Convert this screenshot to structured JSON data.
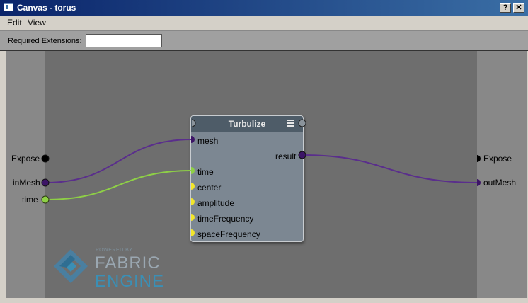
{
  "window": {
    "title": "Canvas - torus",
    "help_label": "?",
    "close_label": "✕"
  },
  "menu": {
    "items": [
      {
        "label": "Edit"
      },
      {
        "label": "View"
      }
    ]
  },
  "toolbar": {
    "required_extensions_label": "Required Extensions:",
    "required_extensions_value": ""
  },
  "graph": {
    "left_ports": [
      {
        "label": "Expose"
      },
      {
        "label": "inMesh"
      },
      {
        "label": "time"
      }
    ],
    "right_ports": [
      {
        "label": "Expose"
      },
      {
        "label": "outMesh"
      }
    ],
    "node": {
      "title": "Turbulize",
      "inputs": [
        {
          "label": "mesh"
        },
        {
          "label": "time"
        },
        {
          "label": "center"
        },
        {
          "label": "amplitude"
        },
        {
          "label": "timeFrequency"
        },
        {
          "label": "spaceFrequency"
        }
      ],
      "output": {
        "label": "result"
      }
    },
    "colors": {
      "mesh_wire": "#5a2e8c",
      "time_wire": "#8ed046",
      "mesh_port": "#3c1466",
      "time_port": "#8ed046",
      "scalar_port": "#f2e62a",
      "expose_port": "#000000"
    }
  },
  "logo": {
    "powered_by": "POWERED BY",
    "line1": "FABRIC",
    "line2": "ENGINE"
  }
}
